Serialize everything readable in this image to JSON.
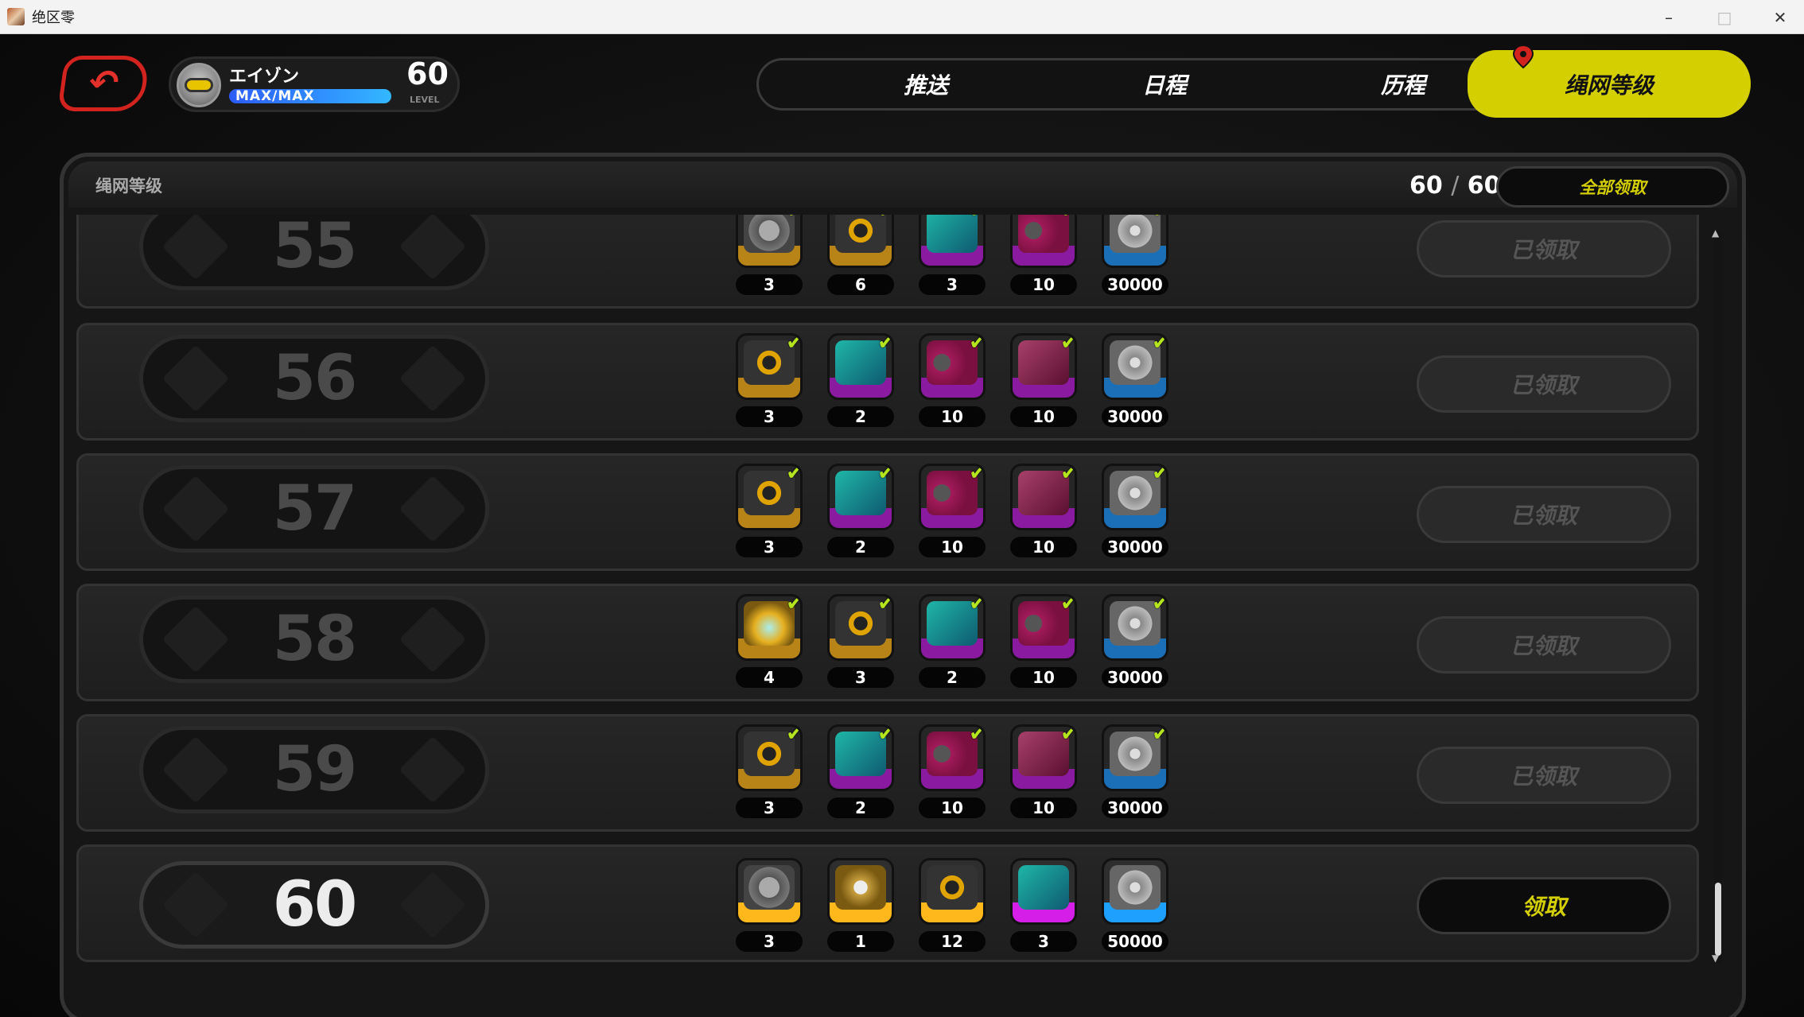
{
  "window": {
    "title": "绝区零"
  },
  "profile": {
    "name": "エイゾン",
    "level_bar_text": "MAX/MAX",
    "level": "60",
    "level_caption": "LEVEL"
  },
  "tabs": [
    {
      "label": "推送"
    },
    {
      "label": "日程"
    },
    {
      "label": "历程"
    },
    {
      "label": "绳网等级",
      "active": true
    }
  ],
  "panel": {
    "title": "绳网等级",
    "counter_current": "60",
    "counter_sep": "/",
    "counter_max": "60",
    "claim_all_label": "全部领取"
  },
  "rows": [
    {
      "level": "55",
      "status": "已领取",
      "rewards": [
        {
          "icon": "film-reel-icon",
          "qty": "3"
        },
        {
          "icon": "gold-disc-icon",
          "qty": "6"
        },
        {
          "icon": "cube-icon",
          "qty": "3"
        },
        {
          "icon": "goggles-icon",
          "qty": "10"
        },
        {
          "icon": "denny-star-icon",
          "qty": "30000"
        }
      ]
    },
    {
      "level": "56",
      "status": "已领取",
      "rewards": [
        {
          "icon": "gold-disc-icon",
          "qty": "3"
        },
        {
          "icon": "cube-icon",
          "qty": "2"
        },
        {
          "icon": "goggles-icon",
          "qty": "10"
        },
        {
          "icon": "pad-icon",
          "qty": "10"
        },
        {
          "icon": "denny-star-icon",
          "qty": "30000"
        }
      ]
    },
    {
      "level": "57",
      "status": "已领取",
      "rewards": [
        {
          "icon": "gold-disc-icon",
          "qty": "3"
        },
        {
          "icon": "cube-icon",
          "qty": "2"
        },
        {
          "icon": "goggles-icon",
          "qty": "10"
        },
        {
          "icon": "pad-icon",
          "qty": "10"
        },
        {
          "icon": "denny-star-icon",
          "qty": "30000"
        }
      ]
    },
    {
      "level": "58",
      "status": "已领取",
      "rewards": [
        {
          "icon": "trophy-icon",
          "qty": "4"
        },
        {
          "icon": "gold-disc-icon",
          "qty": "3"
        },
        {
          "icon": "cube-icon",
          "qty": "2"
        },
        {
          "icon": "goggles-icon",
          "qty": "10"
        },
        {
          "icon": "denny-star-icon",
          "qty": "30000"
        }
      ]
    },
    {
      "level": "59",
      "status": "已领取",
      "rewards": [
        {
          "icon": "gold-disc-icon",
          "qty": "3"
        },
        {
          "icon": "cube-icon",
          "qty": "2"
        },
        {
          "icon": "goggles-icon",
          "qty": "10"
        },
        {
          "icon": "pad-icon",
          "qty": "10"
        },
        {
          "icon": "denny-star-icon",
          "qty": "30000"
        }
      ]
    },
    {
      "level": "60",
      "status": "领取",
      "rewards": [
        {
          "icon": "film-reel-icon",
          "qty": "3"
        },
        {
          "icon": "coil-icon",
          "qty": "1"
        },
        {
          "icon": "gold-disc-icon",
          "qty": "12"
        },
        {
          "icon": "cube-icon",
          "qty": "3"
        },
        {
          "icon": "denny-star-icon",
          "qty": "50000"
        }
      ]
    }
  ],
  "colors": {
    "accent": "#d4cf00",
    "back": "#d3231f",
    "check": "#b5e61d",
    "level_bar": "#33b7ff"
  }
}
